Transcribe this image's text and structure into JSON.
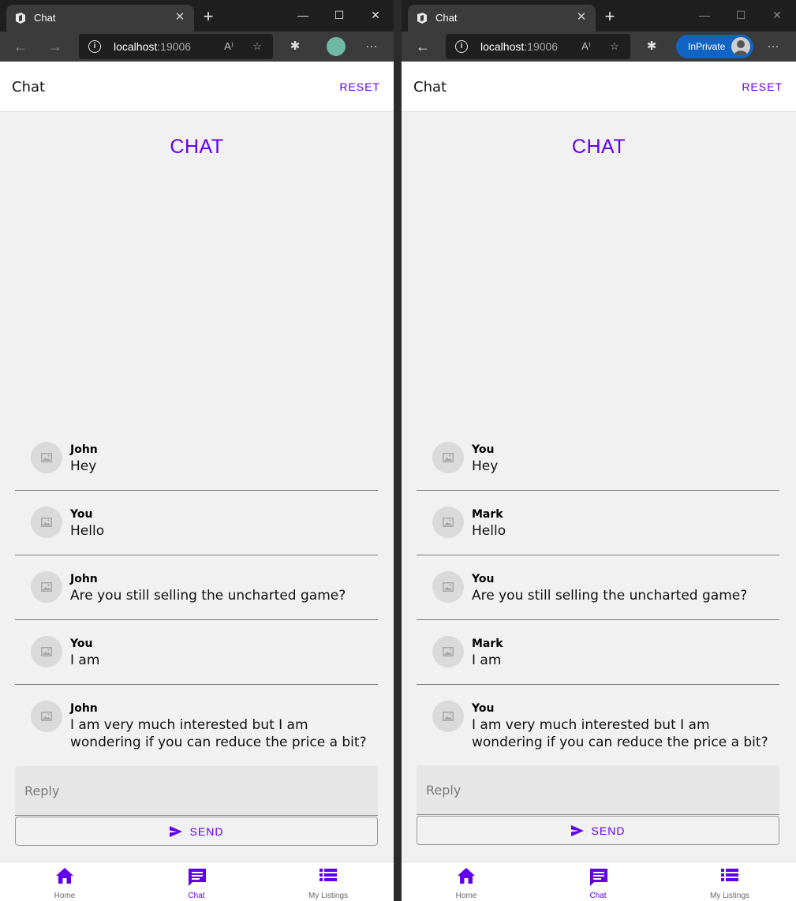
{
  "left": {
    "browser": {
      "tab_title": "Chat",
      "url_host": "localhost",
      "url_port": ":19006"
    },
    "app": {
      "appbar_title": "Chat",
      "reset_label": "RESET",
      "heading": "CHAT",
      "messages": [
        {
          "sender": "John",
          "text": "Hey"
        },
        {
          "sender": "You",
          "text": "Hello"
        },
        {
          "sender": "John",
          "text": "Are you still selling the uncharted game?"
        },
        {
          "sender": "You",
          "text": "I am"
        },
        {
          "sender": "John",
          "text": "I am very much interested but I am wondering if you can reduce the price a bit?"
        }
      ],
      "reply_placeholder": "Reply",
      "send_label": "SEND",
      "nav": [
        {
          "label": "Home",
          "active": false
        },
        {
          "label": "Chat",
          "active": true
        },
        {
          "label": "My Listings",
          "active": false
        }
      ]
    }
  },
  "right": {
    "browser": {
      "tab_title": "Chat",
      "url_host": "localhost",
      "url_port": ":19006",
      "inprivate_label": "InPrivate"
    },
    "app": {
      "appbar_title": "Chat",
      "reset_label": "RESET",
      "heading": "CHAT",
      "messages": [
        {
          "sender": "You",
          "text": "Hey"
        },
        {
          "sender": "Mark",
          "text": "Hello"
        },
        {
          "sender": "You",
          "text": "Are you still selling the uncharted game?"
        },
        {
          "sender": "Mark",
          "text": "I am"
        },
        {
          "sender": "You",
          "text": "I am very much interested but I am wondering if you can reduce the price a bit?"
        }
      ],
      "reply_placeholder": "Reply",
      "send_label": "SEND",
      "nav": [
        {
          "label": "Home",
          "active": false
        },
        {
          "label": "Chat",
          "active": true
        },
        {
          "label": "My Listings",
          "active": false
        }
      ]
    }
  },
  "colors": {
    "accent": "#6200ee",
    "inprivate": "#1264c4"
  }
}
